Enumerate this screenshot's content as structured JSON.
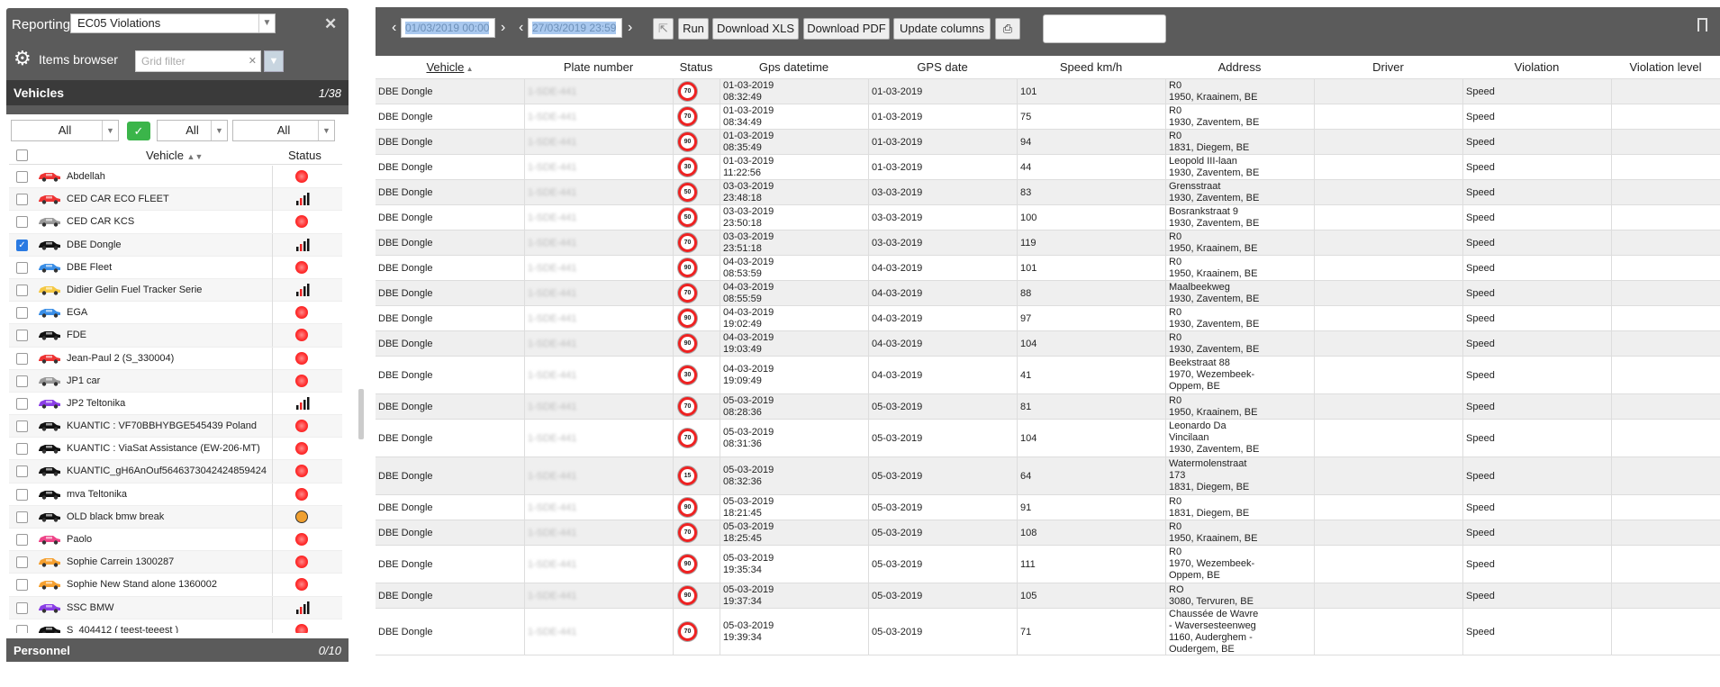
{
  "left_panel": {
    "title": "Reporting",
    "report_select": "EC05 Violations",
    "items_browser": "Items browser",
    "grid_filter_placeholder": "Grid filter",
    "vehicles_label": "Vehicles",
    "vehicles_count": "1/38",
    "filters": [
      "All",
      "All",
      "All"
    ],
    "col_vehicle": "Vehicle",
    "col_status": "Status",
    "personnel_label": "Personnel",
    "personnel_count": "0/10",
    "vehicles": [
      {
        "name": "Abdellah",
        "color": "#e33",
        "status": "red",
        "checked": false
      },
      {
        "name": "CED CAR ECO FLEET",
        "color": "#e33",
        "status": "signal",
        "checked": false
      },
      {
        "name": "CED CAR KCS",
        "color": "#999",
        "status": "red",
        "checked": false
      },
      {
        "name": "DBE Dongle",
        "color": "#111",
        "status": "signal",
        "checked": true
      },
      {
        "name": "DBE Fleet",
        "color": "#3a8ee6",
        "status": "red",
        "checked": false
      },
      {
        "name": "Didier Gelin Fuel Tracker Serie",
        "color": "#f5c842",
        "status": "signal",
        "checked": false
      },
      {
        "name": "EGA",
        "color": "#3a8ee6",
        "status": "red",
        "checked": false
      },
      {
        "name": "FDE",
        "color": "#111",
        "status": "red",
        "checked": false
      },
      {
        "name": "Jean-Paul 2 (S_330004)",
        "color": "#e33",
        "status": "red",
        "checked": false
      },
      {
        "name": "JP1 car",
        "color": "#999",
        "status": "red",
        "checked": false
      },
      {
        "name": "JP2 Teltonika",
        "color": "#8a3ee6",
        "status": "signal",
        "checked": false
      },
      {
        "name": "KUANTIC : VF70BBHYBGE545439 Poland",
        "color": "#111",
        "status": "red",
        "checked": false
      },
      {
        "name": "KUANTIC : ViaSat Assistance (EW-206-MT)",
        "color": "#111",
        "status": "red",
        "checked": false
      },
      {
        "name": "KUANTIC_gH6AnOuf5646373042424859424",
        "color": "#111",
        "status": "red",
        "checked": false
      },
      {
        "name": "mva Teltonika",
        "color": "#111",
        "status": "red",
        "checked": false
      },
      {
        "name": "OLD black bmw break",
        "color": "#111",
        "status": "orange",
        "checked": false
      },
      {
        "name": "Paolo",
        "color": "#ee4488",
        "status": "red",
        "checked": false
      },
      {
        "name": "Sophie Carrein 1300287",
        "color": "#f5a030",
        "status": "red",
        "checked": false
      },
      {
        "name": "Sophie New Stand alone 1360002",
        "color": "#f5a030",
        "status": "red",
        "checked": false
      },
      {
        "name": "SSC BMW",
        "color": "#8a3ee6",
        "status": "signal",
        "checked": false
      },
      {
        "name": "S_404412 ( teest-teeest )",
        "color": "#111",
        "status": "red",
        "checked": false
      }
    ]
  },
  "toolbar": {
    "date_from": "01/03/2019 00:00",
    "date_to": "27/03/2019 23:59",
    "run": "Run",
    "download_xls": "Download XLS",
    "download_pdf": "Download PDF",
    "update_columns": "Update columns"
  },
  "table": {
    "headers": [
      "Vehicle",
      "Plate number",
      "Status",
      "Gps datetime",
      "GPS date",
      "Speed km/h",
      "Address",
      "Driver",
      "Violation",
      "Violation level"
    ],
    "rows": [
      {
        "vehicle": "DBE Dongle",
        "plate": "1-SDE-441",
        "limit": "70",
        "dt": [
          "01-03-2019",
          "08:32:49"
        ],
        "date": "01-03-2019",
        "speed": "101",
        "addr": [
          "R0",
          "1950, Kraainem, BE"
        ],
        "driver": "",
        "violation": "Speed",
        "level": ""
      },
      {
        "vehicle": "DBE Dongle",
        "plate": "1-SDE-441",
        "limit": "70",
        "dt": [
          "01-03-2019",
          "08:34:49"
        ],
        "date": "01-03-2019",
        "speed": "75",
        "addr": [
          "R0",
          "1930, Zaventem, BE"
        ],
        "driver": "",
        "violation": "Speed",
        "level": ""
      },
      {
        "vehicle": "DBE Dongle",
        "plate": "1-SDE-441",
        "limit": "90",
        "dt": [
          "01-03-2019",
          "08:35:49"
        ],
        "date": "01-03-2019",
        "speed": "94",
        "addr": [
          "R0",
          "1831, Diegem, BE"
        ],
        "driver": "",
        "violation": "Speed",
        "level": ""
      },
      {
        "vehicle": "DBE Dongle",
        "plate": "1-SDE-441",
        "limit": "30",
        "dt": [
          "01-03-2019",
          "11:22:56"
        ],
        "date": "01-03-2019",
        "speed": "44",
        "addr": [
          "Leopold III-laan",
          "1930, Zaventem, BE"
        ],
        "driver": "",
        "violation": "Speed",
        "level": ""
      },
      {
        "vehicle": "DBE Dongle",
        "plate": "1-SDE-441",
        "limit": "50",
        "dt": [
          "03-03-2019",
          "23:48:18"
        ],
        "date": "03-03-2019",
        "speed": "83",
        "addr": [
          "Grensstraat",
          "1930, Zaventem, BE"
        ],
        "driver": "",
        "violation": "Speed",
        "level": ""
      },
      {
        "vehicle": "DBE Dongle",
        "plate": "1-SDE-441",
        "limit": "50",
        "dt": [
          "03-03-2019",
          "23:50:18"
        ],
        "date": "03-03-2019",
        "speed": "100",
        "addr": [
          "Bosrankstraat 9",
          "1930, Zaventem, BE"
        ],
        "driver": "",
        "violation": "Speed",
        "level": ""
      },
      {
        "vehicle": "DBE Dongle",
        "plate": "1-SDE-441",
        "limit": "70",
        "dt": [
          "03-03-2019",
          "23:51:18"
        ],
        "date": "03-03-2019",
        "speed": "119",
        "addr": [
          "R0",
          "1950, Kraainem, BE"
        ],
        "driver": "",
        "violation": "Speed",
        "level": ""
      },
      {
        "vehicle": "DBE Dongle",
        "plate": "1-SDE-441",
        "limit": "90",
        "dt": [
          "04-03-2019",
          "08:53:59"
        ],
        "date": "04-03-2019",
        "speed": "101",
        "addr": [
          "R0",
          "1950, Kraainem, BE"
        ],
        "driver": "",
        "violation": "Speed",
        "level": ""
      },
      {
        "vehicle": "DBE Dongle",
        "plate": "1-SDE-441",
        "limit": "70",
        "dt": [
          "04-03-2019",
          "08:55:59"
        ],
        "date": "04-03-2019",
        "speed": "88",
        "addr": [
          "Maalbeekweg",
          "1930, Zaventem, BE"
        ],
        "driver": "",
        "violation": "Speed",
        "level": ""
      },
      {
        "vehicle": "DBE Dongle",
        "plate": "1-SDE-441",
        "limit": "90",
        "dt": [
          "04-03-2019",
          "19:02:49"
        ],
        "date": "04-03-2019",
        "speed": "97",
        "addr": [
          "R0",
          "1930, Zaventem, BE"
        ],
        "driver": "",
        "violation": "Speed",
        "level": ""
      },
      {
        "vehicle": "DBE Dongle",
        "plate": "1-SDE-441",
        "limit": "90",
        "dt": [
          "04-03-2019",
          "19:03:49"
        ],
        "date": "04-03-2019",
        "speed": "104",
        "addr": [
          "R0",
          "1930, Zaventem, BE"
        ],
        "driver": "",
        "violation": "Speed",
        "level": ""
      },
      {
        "vehicle": "DBE Dongle",
        "plate": "1-SDE-441",
        "limit": "30",
        "dt": [
          "04-03-2019",
          "19:09:49"
        ],
        "date": "04-03-2019",
        "speed": "41",
        "addr": [
          "Beekstraat 88",
          "1970, Wezembeek-",
          "Oppem, BE"
        ],
        "driver": "",
        "violation": "Speed",
        "level": ""
      },
      {
        "vehicle": "DBE Dongle",
        "plate": "1-SDE-441",
        "limit": "70",
        "dt": [
          "05-03-2019",
          "08:28:36"
        ],
        "date": "05-03-2019",
        "speed": "81",
        "addr": [
          "R0",
          "1950, Kraainem, BE"
        ],
        "driver": "",
        "violation": "Speed",
        "level": ""
      },
      {
        "vehicle": "DBE Dongle",
        "plate": "1-SDE-441",
        "limit": "70",
        "dt": [
          "05-03-2019",
          "08:31:36"
        ],
        "date": "05-03-2019",
        "speed": "104",
        "addr": [
          "Leonardo Da",
          "Vincilaan",
          "1930, Zaventem, BE"
        ],
        "driver": "",
        "violation": "Speed",
        "level": ""
      },
      {
        "vehicle": "DBE Dongle",
        "plate": "1-SDE-441",
        "limit": "15",
        "dt": [
          "05-03-2019",
          "08:32:36"
        ],
        "date": "05-03-2019",
        "speed": "64",
        "addr": [
          "Watermolenstraat",
          "173",
          "1831, Diegem, BE"
        ],
        "driver": "",
        "violation": "Speed",
        "level": ""
      },
      {
        "vehicle": "DBE Dongle",
        "plate": "1-SDE-441",
        "limit": "90",
        "dt": [
          "05-03-2019",
          "18:21:45"
        ],
        "date": "05-03-2019",
        "speed": "91",
        "addr": [
          "R0",
          "1831, Diegem, BE"
        ],
        "driver": "",
        "violation": "Speed",
        "level": ""
      },
      {
        "vehicle": "DBE Dongle",
        "plate": "1-SDE-441",
        "limit": "70",
        "dt": [
          "05-03-2019",
          "18:25:45"
        ],
        "date": "05-03-2019",
        "speed": "108",
        "addr": [
          "R0",
          "1950, Kraainem, BE"
        ],
        "driver": "",
        "violation": "Speed",
        "level": ""
      },
      {
        "vehicle": "DBE Dongle",
        "plate": "1-SDE-441",
        "limit": "90",
        "dt": [
          "05-03-2019",
          "19:35:34"
        ],
        "date": "05-03-2019",
        "speed": "111",
        "addr": [
          "R0",
          "1970, Wezembeek-",
          "Oppem, BE"
        ],
        "driver": "",
        "violation": "Speed",
        "level": ""
      },
      {
        "vehicle": "DBE Dongle",
        "plate": "1-SDE-441",
        "limit": "90",
        "dt": [
          "05-03-2019",
          "19:37:34"
        ],
        "date": "05-03-2019",
        "speed": "105",
        "addr": [
          "RO",
          "3080, Tervuren, BE"
        ],
        "driver": "",
        "violation": "Speed",
        "level": ""
      },
      {
        "vehicle": "DBE Dongle",
        "plate": "1-SDE-441",
        "limit": "70",
        "dt": [
          "05-03-2019",
          "19:39:34"
        ],
        "date": "05-03-2019",
        "speed": "71",
        "addr": [
          "Chaussée de Wavre",
          "- Waversesteenweg",
          "1160, Auderghem -",
          "Oudergem, BE"
        ],
        "driver": "",
        "violation": "Speed",
        "level": ""
      }
    ]
  }
}
